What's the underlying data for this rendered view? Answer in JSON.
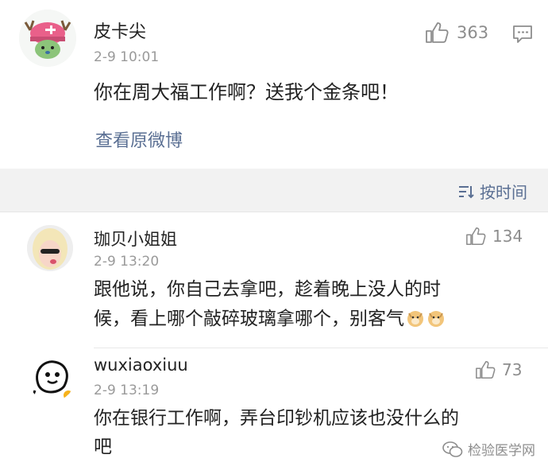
{
  "post": {
    "username": "皮卡尖",
    "time": "2-9 10:01",
    "content": "你在周大福工作啊？送我个金条吧！",
    "likes": "363",
    "view_original": "查看原微博"
  },
  "sort": {
    "label": "按时间"
  },
  "comments": [
    {
      "username": "珈贝小姐姐",
      "time": "2-9 13:20",
      "likes": "134",
      "line1": "跟他说，你自己去拿吧，趁着晚上没人的时",
      "line2": "候，看上哪个敲碎玻璃拿哪个，别客气"
    },
    {
      "username": "wuxiaoxiuu",
      "time": "2-9 13:19",
      "likes": "73",
      "line1": "你在银行工作啊，弄台印钞机应该也没什么的",
      "line2": "吧"
    }
  ],
  "watermark": {
    "text": "检验医学网"
  },
  "colors": {
    "link": "#5a6f93",
    "gray": "#9a9a9a",
    "section_bg": "#f2f2f2"
  }
}
